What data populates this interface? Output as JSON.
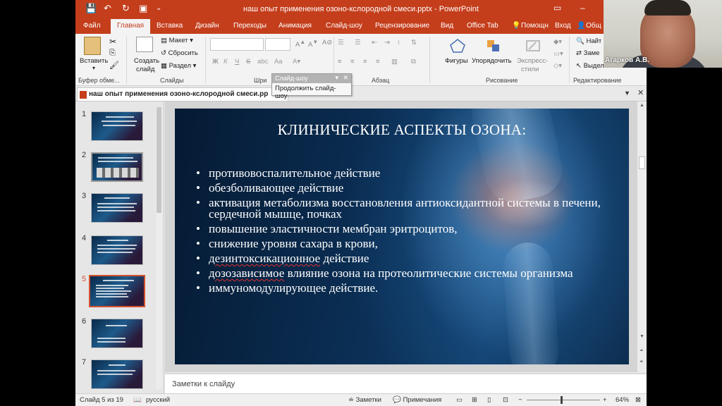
{
  "titlebar": {
    "title": "наш опыт применения озоно-кслородной смеси.pptx - PowerPoint"
  },
  "tabs": [
    "Файл",
    "Главная",
    "Вставка",
    "Дизайн",
    "Переходы",
    "Анимация",
    "Слайд-шоу",
    "Рецензирование",
    "Вид",
    "Office Tab",
    "Помощн",
    "Вход",
    "Общ"
  ],
  "ribbon": {
    "paste": "Вставить",
    "clipboard_group": "Буфер обме...",
    "create_slide": "Создать",
    "create_slide2": "слайд",
    "layout": "Макет",
    "reset": "Сбросить",
    "section": "Раздел",
    "slides_group": "Слайды",
    "font_group": "Шри",
    "paragraph_group": "Абзац",
    "shapes": "Фигуры",
    "arrange": "Упорядочить",
    "quick_styles": "Экспресс-",
    "quick_styles2": "стили",
    "drawing_group": "Рисование",
    "find": "Найт",
    "replace": "Заме",
    "select": "Выдели",
    "editing_group": "Редактирование"
  },
  "popup": {
    "header": "Слайд-шоу",
    "item": "Продолжить слайд-шоу"
  },
  "doc_tab": "наш опыт применения озоно-кслородной смеси.pp",
  "thumbnails": [
    "1",
    "2",
    "3",
    "4",
    "5",
    "6",
    "7"
  ],
  "slide": {
    "title": "КЛИНИЧЕСКИЕ АСПЕКТЫ ОЗОНА:",
    "bullets": [
      "противовоспалительное действие",
      "обезболивающее действие",
      "активация метаболизма восстановления антиоксидантной системы в печени, сердечной мышце,  почках",
      "повышение эластичности мембран эритроцитов,",
      "снижение уровня сахара в крови,",
      "действие",
      "влияние озона на протеолитические системы организма",
      "иммуномодулирующее действие."
    ],
    "squiggly": [
      "дезинтоксикационное",
      "дозозависимое"
    ]
  },
  "notes": "Заметки к слайду",
  "status": {
    "slide_info": "Слайд 5 из 19",
    "language": "русский",
    "notes_btn": "Заметки",
    "comments_btn": "Примечания",
    "zoom": "64%"
  },
  "webcam": {
    "name": "Агарков А.В."
  }
}
